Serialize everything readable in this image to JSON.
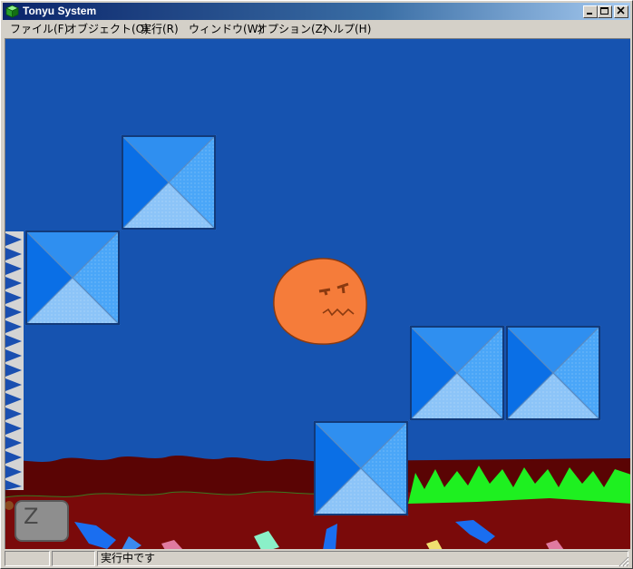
{
  "window": {
    "title": "Tonyu System"
  },
  "menu": {
    "items": [
      {
        "label": "ファイル(F)"
      },
      {
        "label": "オブジェクト(O)"
      },
      {
        "label": "実行(R)"
      },
      {
        "label": "ウィンドウ(W)"
      },
      {
        "label": "オプション(Z)"
      },
      {
        "label": "ヘルプ(H)"
      }
    ]
  },
  "game": {
    "button_label": "Z"
  },
  "status": {
    "text": "実行中です"
  },
  "colors": {
    "sky": "#1653b0",
    "block_light": "#3a96f0",
    "block_dark": "#0a6ae0",
    "ground": "#7a0a0a",
    "grass": "#1ef020",
    "face": "#f57c3a"
  }
}
